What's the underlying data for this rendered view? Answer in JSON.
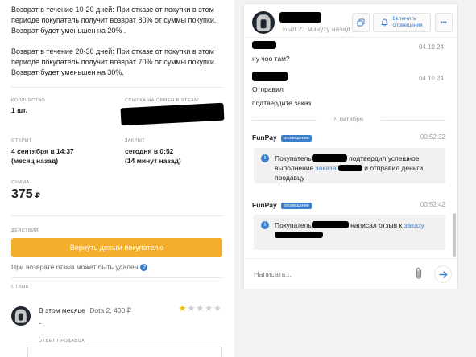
{
  "order": {
    "refund_rules": [
      "Возврат в течение 10-20 дней: При отказе от покупки в этом периоде покупатель получит возврат 80% от суммы покупки. Возврат будет уменьшен на 20% .",
      "Возврат в течение 20-30 дней: При отказе от покупки в этом периоде покупатель получит возврат 70% от суммы покупки. Возврат будет уменьшен на 30%."
    ],
    "quantity_label": "КОЛИЧЕСТВО",
    "quantity_value": "1 шт.",
    "exchange_label": "ССЫЛКА НА ОБМЕН В STEAM",
    "opened_label": "ОТКРЫТ",
    "opened_value": "4 сентября в 14:37",
    "opened_ago": "(месяц назад)",
    "closed_label": "ЗАКРЫТ",
    "closed_value": "сегодня в 0:52",
    "closed_ago": "(14 минут назад)",
    "sum_label": "СУММА",
    "sum_value": "375",
    "currency": "₽",
    "actions_label": "ДЕЙСТВИЯ",
    "refund_button": "Вернуть деньги покупателю",
    "refund_note": "При возврате отзыв может быть удален",
    "help_icon": "?",
    "review_label": "ОТЗЫВ",
    "review": {
      "period": "В этом месяце",
      "game_price": "Dota 2, 400 ₽",
      "text": "-",
      "stars_filled": 1,
      "stars_total": 5,
      "star_glyph": "★"
    },
    "seller_reply_label": "ОТВЕТ ПРОДАВЦА"
  },
  "chat": {
    "status": "Был 21 минуту назад",
    "notify_label_1": "Включить",
    "notify_label_2": "оповещения",
    "more_label": "•••",
    "messages": [
      {
        "text": "ну чоо там?",
        "date": "04.10.24"
      },
      {
        "text": "Отправил",
        "date": "04.10.24"
      },
      {
        "text": "подтвердите заказ"
      }
    ],
    "day_separator": "5 октября",
    "system_messages": [
      {
        "sender": "FunPay",
        "badge": "оповещение",
        "time": "00:52:32",
        "part1": "Покупатель",
        "part2": "подтвердил успешное выполнение",
        "link1": "заказа",
        "part3": "и отправил деньги продавцу",
        "info": "i"
      },
      {
        "sender": "FunPay",
        "badge": "оповещение",
        "time": "00:52:42",
        "part1": "Покупатель",
        "part2": "написал отзыв к",
        "link1": "заказу",
        "info": "i"
      }
    ],
    "input_placeholder": "Написать..."
  },
  "colors": {
    "accent_orange": "#f5ad2c",
    "link_blue": "#3a7ecd",
    "star_gold": "#f2c100"
  },
  "icons": [
    "copy-icon",
    "bell-icon",
    "more-icon",
    "help-icon",
    "info-icon",
    "paperclip-icon",
    "send-arrow-icon",
    "star-icon"
  ]
}
